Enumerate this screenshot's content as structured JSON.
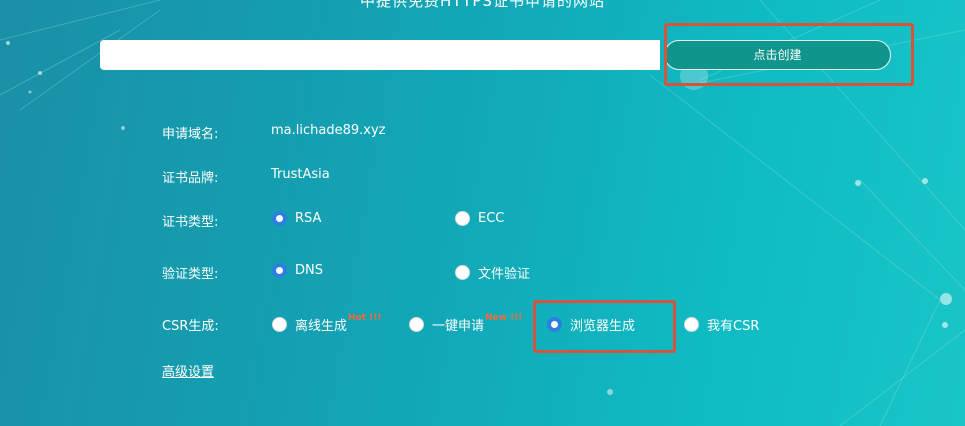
{
  "header": {
    "heading": "中提供免费HTTPS证书申请的网站"
  },
  "search": {
    "value": "",
    "button_label": "点击创建"
  },
  "form": {
    "domain": {
      "label": "申请域名:",
      "value": "ma.lichade89.xyz"
    },
    "brand": {
      "label": "证书品牌:",
      "value": "TrustAsia"
    },
    "cert_type": {
      "label": "证书类型:",
      "options": [
        {
          "label": "RSA",
          "checked": true
        },
        {
          "label": "ECC",
          "checked": false
        }
      ]
    },
    "verify_type": {
      "label": "验证类型:",
      "options": [
        {
          "label": "DNS",
          "checked": true
        },
        {
          "label": "文件验证",
          "checked": false
        }
      ]
    },
    "csr": {
      "label": "CSR生成:",
      "options": [
        {
          "label": "离线生成",
          "tag": "Hot !!!",
          "checked": false
        },
        {
          "label": "一键申请",
          "tag": "New !!!",
          "checked": false
        },
        {
          "label": "浏览器生成",
          "checked": true
        },
        {
          "label": "我有CSR",
          "checked": false
        }
      ]
    },
    "advanced_label": "高级设置"
  },
  "colors": {
    "accent_button": "#0f958c",
    "radio_checked": "#2a7fe0",
    "highlight": "#d5543b",
    "tag": "#f26a3c"
  }
}
